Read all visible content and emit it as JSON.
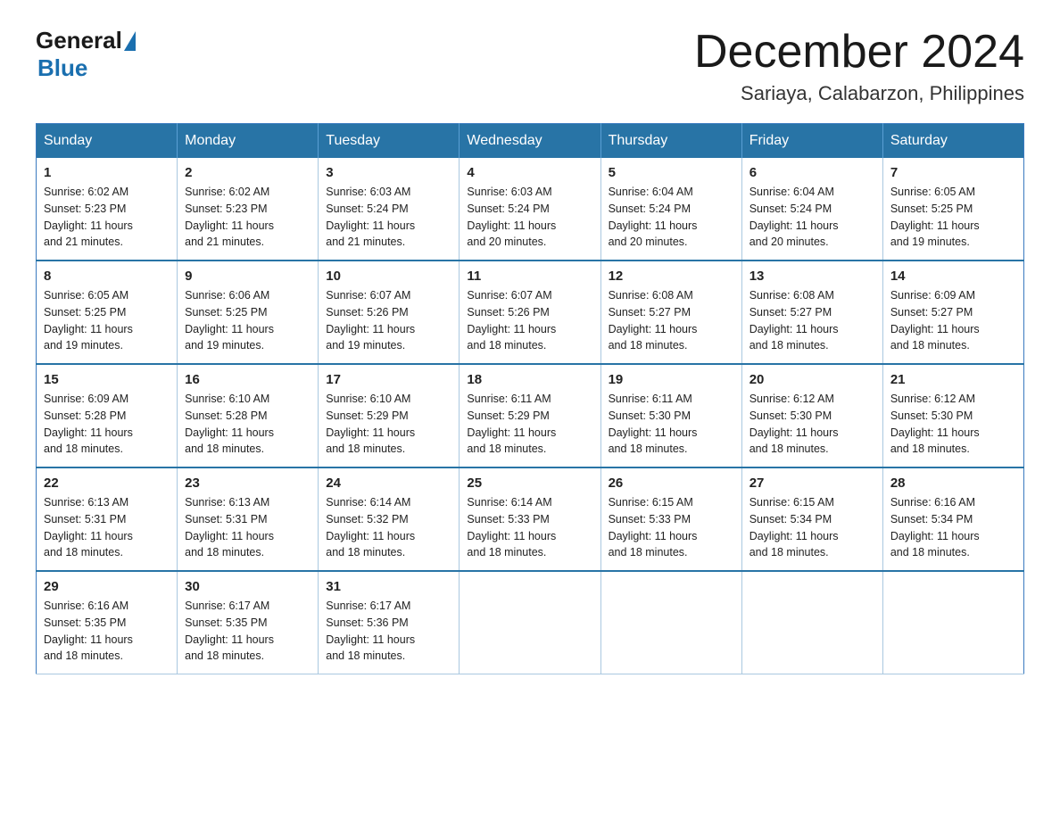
{
  "header": {
    "logo_line1": "General",
    "logo_line2": "Blue",
    "month_title": "December 2024",
    "location": "Sariaya, Calabarzon, Philippines"
  },
  "weekdays": [
    "Sunday",
    "Monday",
    "Tuesday",
    "Wednesday",
    "Thursday",
    "Friday",
    "Saturday"
  ],
  "weeks": [
    [
      {
        "day": "1",
        "sunrise": "6:02 AM",
        "sunset": "5:23 PM",
        "daylight": "11 hours and 21 minutes."
      },
      {
        "day": "2",
        "sunrise": "6:02 AM",
        "sunset": "5:23 PM",
        "daylight": "11 hours and 21 minutes."
      },
      {
        "day": "3",
        "sunrise": "6:03 AM",
        "sunset": "5:24 PM",
        "daylight": "11 hours and 21 minutes."
      },
      {
        "day": "4",
        "sunrise": "6:03 AM",
        "sunset": "5:24 PM",
        "daylight": "11 hours and 20 minutes."
      },
      {
        "day": "5",
        "sunrise": "6:04 AM",
        "sunset": "5:24 PM",
        "daylight": "11 hours and 20 minutes."
      },
      {
        "day": "6",
        "sunrise": "6:04 AM",
        "sunset": "5:24 PM",
        "daylight": "11 hours and 20 minutes."
      },
      {
        "day": "7",
        "sunrise": "6:05 AM",
        "sunset": "5:25 PM",
        "daylight": "11 hours and 19 minutes."
      }
    ],
    [
      {
        "day": "8",
        "sunrise": "6:05 AM",
        "sunset": "5:25 PM",
        "daylight": "11 hours and 19 minutes."
      },
      {
        "day": "9",
        "sunrise": "6:06 AM",
        "sunset": "5:25 PM",
        "daylight": "11 hours and 19 minutes."
      },
      {
        "day": "10",
        "sunrise": "6:07 AM",
        "sunset": "5:26 PM",
        "daylight": "11 hours and 19 minutes."
      },
      {
        "day": "11",
        "sunrise": "6:07 AM",
        "sunset": "5:26 PM",
        "daylight": "11 hours and 18 minutes."
      },
      {
        "day": "12",
        "sunrise": "6:08 AM",
        "sunset": "5:27 PM",
        "daylight": "11 hours and 18 minutes."
      },
      {
        "day": "13",
        "sunrise": "6:08 AM",
        "sunset": "5:27 PM",
        "daylight": "11 hours and 18 minutes."
      },
      {
        "day": "14",
        "sunrise": "6:09 AM",
        "sunset": "5:27 PM",
        "daylight": "11 hours and 18 minutes."
      }
    ],
    [
      {
        "day": "15",
        "sunrise": "6:09 AM",
        "sunset": "5:28 PM",
        "daylight": "11 hours and 18 minutes."
      },
      {
        "day": "16",
        "sunrise": "6:10 AM",
        "sunset": "5:28 PM",
        "daylight": "11 hours and 18 minutes."
      },
      {
        "day": "17",
        "sunrise": "6:10 AM",
        "sunset": "5:29 PM",
        "daylight": "11 hours and 18 minutes."
      },
      {
        "day": "18",
        "sunrise": "6:11 AM",
        "sunset": "5:29 PM",
        "daylight": "11 hours and 18 minutes."
      },
      {
        "day": "19",
        "sunrise": "6:11 AM",
        "sunset": "5:30 PM",
        "daylight": "11 hours and 18 minutes."
      },
      {
        "day": "20",
        "sunrise": "6:12 AM",
        "sunset": "5:30 PM",
        "daylight": "11 hours and 18 minutes."
      },
      {
        "day": "21",
        "sunrise": "6:12 AM",
        "sunset": "5:30 PM",
        "daylight": "11 hours and 18 minutes."
      }
    ],
    [
      {
        "day": "22",
        "sunrise": "6:13 AM",
        "sunset": "5:31 PM",
        "daylight": "11 hours and 18 minutes."
      },
      {
        "day": "23",
        "sunrise": "6:13 AM",
        "sunset": "5:31 PM",
        "daylight": "11 hours and 18 minutes."
      },
      {
        "day": "24",
        "sunrise": "6:14 AM",
        "sunset": "5:32 PM",
        "daylight": "11 hours and 18 minutes."
      },
      {
        "day": "25",
        "sunrise": "6:14 AM",
        "sunset": "5:33 PM",
        "daylight": "11 hours and 18 minutes."
      },
      {
        "day": "26",
        "sunrise": "6:15 AM",
        "sunset": "5:33 PM",
        "daylight": "11 hours and 18 minutes."
      },
      {
        "day": "27",
        "sunrise": "6:15 AM",
        "sunset": "5:34 PM",
        "daylight": "11 hours and 18 minutes."
      },
      {
        "day": "28",
        "sunrise": "6:16 AM",
        "sunset": "5:34 PM",
        "daylight": "11 hours and 18 minutes."
      }
    ],
    [
      {
        "day": "29",
        "sunrise": "6:16 AM",
        "sunset": "5:35 PM",
        "daylight": "11 hours and 18 minutes."
      },
      {
        "day": "30",
        "sunrise": "6:17 AM",
        "sunset": "5:35 PM",
        "daylight": "11 hours and 18 minutes."
      },
      {
        "day": "31",
        "sunrise": "6:17 AM",
        "sunset": "5:36 PM",
        "daylight": "11 hours and 18 minutes."
      },
      null,
      null,
      null,
      null
    ]
  ],
  "labels": {
    "sunrise": "Sunrise:",
    "sunset": "Sunset:",
    "daylight": "Daylight:"
  }
}
